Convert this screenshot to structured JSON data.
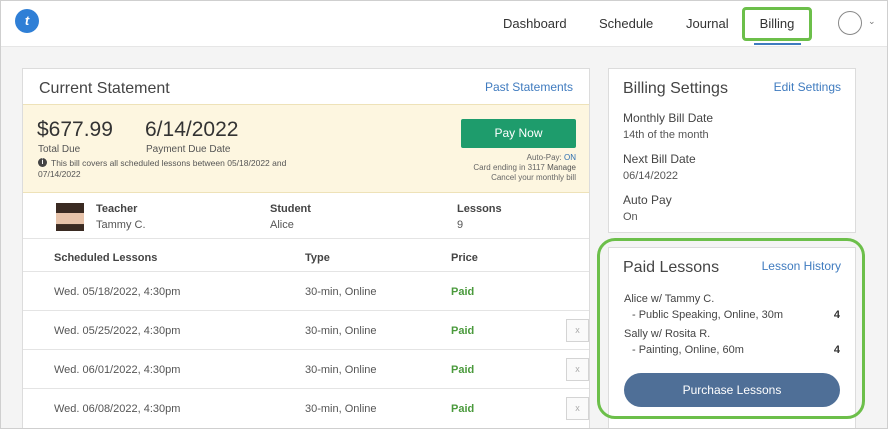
{
  "nav": {
    "logo": "t",
    "items": [
      "Dashboard",
      "Schedule",
      "Journal"
    ],
    "active": "Billing"
  },
  "statement": {
    "title": "Current Statement",
    "past_link": "Past Statements",
    "total_due": "$677.99",
    "total_due_label": "Total Due",
    "due_date": "6/14/2022",
    "due_date_label": "Payment Due Date",
    "note": "This bill covers all scheduled lessons between 05/18/2022 and 07/14/2022",
    "pay_button": "Pay Now",
    "autopay_label": "Auto-Pay:",
    "autopay_value": "ON",
    "card_line": "Card ending in 3117",
    "manage": "Manage",
    "cancel_line": "Cancel your monthly bill",
    "teacher_header": "Teacher",
    "teacher_name": "Tammy C.",
    "student_header": "Student",
    "student_name": "Alice",
    "lessons_header": "Lessons",
    "lessons_count": "9",
    "table_headers": {
      "date": "Scheduled Lessons",
      "type": "Type",
      "price": "Price"
    },
    "rows": [
      {
        "date": "Wed. 05/18/2022, 4:30pm",
        "type": "30-min, Online",
        "price": "Paid"
      },
      {
        "date": "Wed. 05/25/2022, 4:30pm",
        "type": "30-min, Online",
        "price": "Paid"
      },
      {
        "date": "Wed. 06/01/2022, 4:30pm",
        "type": "30-min, Online",
        "price": "Paid"
      },
      {
        "date": "Wed. 06/08/2022, 4:30pm",
        "type": "30-min, Online",
        "price": "Paid"
      }
    ],
    "remove_glyph": "x"
  },
  "settings": {
    "title": "Billing Settings",
    "edit_link": "Edit Settings",
    "monthly_label": "Monthly Bill Date",
    "monthly_value": "14th of the month",
    "next_label": "Next Bill Date",
    "next_value": "06/14/2022",
    "autopay_label": "Auto Pay",
    "autopay_value": "On"
  },
  "paid": {
    "title": "Paid Lessons",
    "history_link": "Lesson History",
    "entries": [
      {
        "who": "Alice w/ Tammy C.",
        "detail": "- Public Speaking, Online, 30m",
        "count": "4"
      },
      {
        "who": "Sally w/ Rosita R.",
        "detail": "- Painting, Online, 60m",
        "count": "4"
      }
    ],
    "purchase_button": "Purchase Lessons"
  },
  "colors": {
    "accent": "#3f7bbf",
    "pay": "#1e9c6c",
    "paid_text": "#4a9a3c",
    "highlight": "#6cbf4a",
    "purchase": "#4f6f97"
  }
}
